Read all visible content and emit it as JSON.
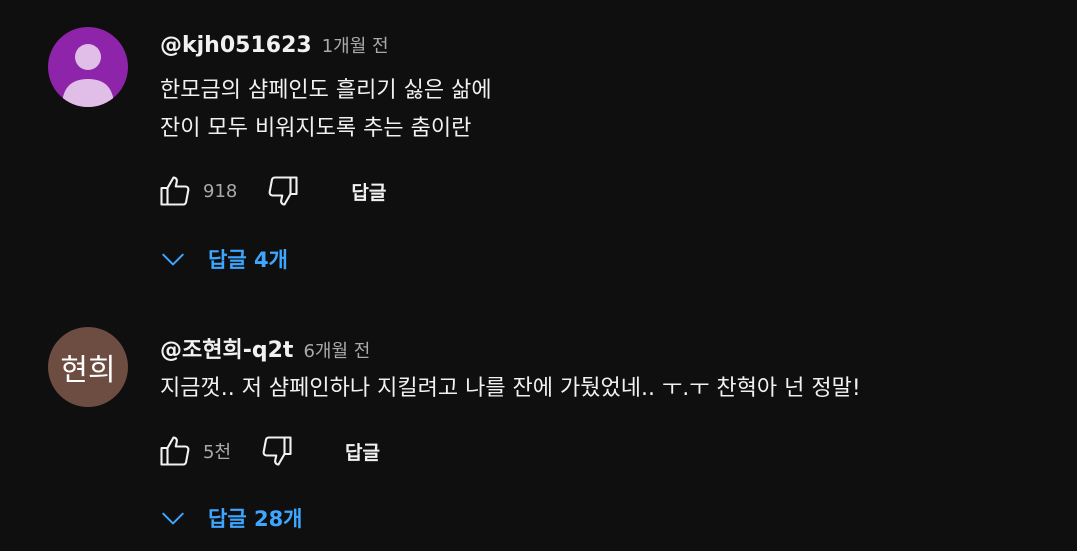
{
  "comments": [
    {
      "author": "@kjh051623",
      "time": "1개월 전",
      "avatar": {
        "type": "person-silhouette",
        "bg": "#8e24aa",
        "fg": "#e1bee7"
      },
      "lines": [
        "한모금의 샴페인도 흘리기 싫은 삶에",
        "잔이 모두 비워지도록 추는 춤이란"
      ],
      "likes": "918",
      "reply_label": "답글",
      "replies_label": "답글 4개"
    },
    {
      "author": "@조현희-q2t",
      "time": "6개월 전",
      "avatar": {
        "type": "text",
        "text": "현희",
        "bg": "#6d4c41"
      },
      "lines": [
        "지금껏..   저 샴페인하나 지킬려고  나를 잔에 가뒀었네..  ㅜ.ㅜ  찬혁아 넌 정말!"
      ],
      "likes": "5천",
      "reply_label": "답글",
      "replies_label": "답글 28개"
    }
  ],
  "icons": {
    "like": "thumb-up-icon",
    "dislike": "thumb-down-icon",
    "expand": "chevron-down-icon"
  },
  "colors": {
    "background": "#0f0f0f",
    "text": "#f1f1f1",
    "secondary_text": "#aaaaaa",
    "link": "#3ea6ff"
  }
}
